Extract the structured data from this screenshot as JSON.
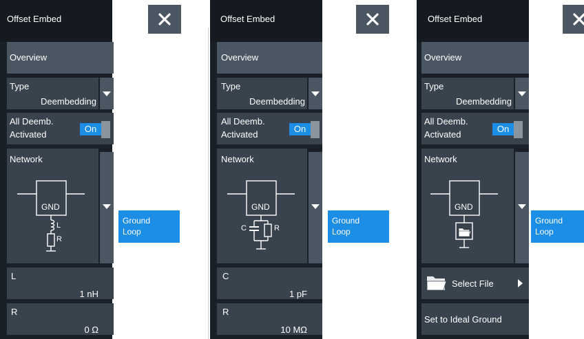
{
  "panels": [
    {
      "title": "Offset Embed",
      "overview": "Overview",
      "type_label": "Type",
      "type_value": "Deembedding",
      "all_deemb_line1": "All Deemb.",
      "all_deemb_line2": "Activated",
      "toggle": "On",
      "network_label": "Network",
      "gnd": "GND",
      "popup_line1": "Ground",
      "popup_line2": "Loop",
      "field1_label": "L",
      "field1_value": "1 nH",
      "field2_label": "R",
      "field2_value": "0 Ω",
      "schem_l": "L",
      "schem_r": "R"
    },
    {
      "title": "Offset Embed",
      "overview": "Overview",
      "type_label": "Type",
      "type_value": "Deembedding",
      "all_deemb_line1": "All Deemb.",
      "all_deemb_line2": "Activated",
      "toggle": "On",
      "network_label": "Network",
      "gnd": "GND",
      "popup_line1": "Ground",
      "popup_line2": "Loop",
      "field1_label": "C",
      "field1_value": "1 pF",
      "field2_label": "R",
      "field2_value": "10 MΩ",
      "schem_c": "C",
      "schem_r": "R"
    },
    {
      "title": "Offset Embed",
      "overview": "Overview",
      "type_label": "Type",
      "type_value": "Deembedding",
      "all_deemb_line1": "All Deemb.",
      "all_deemb_line2": "Activated",
      "toggle": "On",
      "network_label": "Network",
      "gnd": "GND",
      "popup_line1": "Ground",
      "popup_line2": "Loop",
      "select_file": "Select File",
      "ideal_ground": "Set to Ideal Ground"
    }
  ],
  "colors": {
    "panel_bg": "#1a2027",
    "button": "#4a5662",
    "accent_blue": "#1c8ee6"
  },
  "icons": [
    "close-icon",
    "dropdown-arrow-icon",
    "folder-icon",
    "right-arrow-icon"
  ]
}
